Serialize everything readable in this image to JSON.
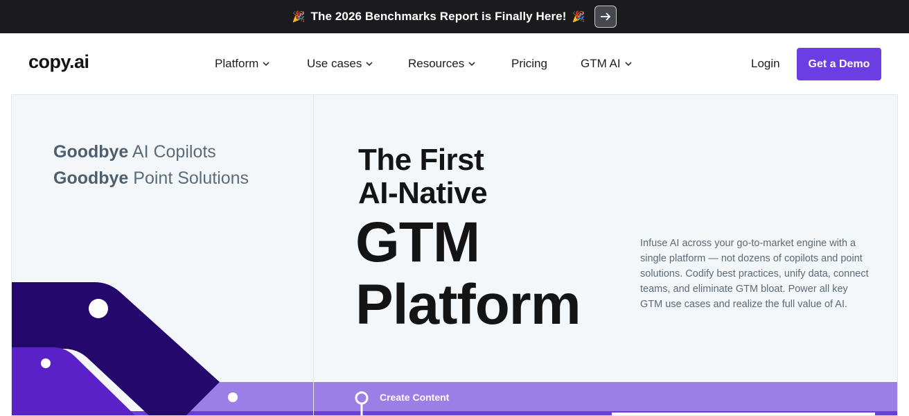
{
  "announcement": {
    "text": "The 2026 Benchmarks Report is Finally Here!",
    "left_emoji": "🎉",
    "right_emoji": "🎉",
    "arrow_icon": "arrow-right-icon"
  },
  "nav": {
    "logo": "copy.ai",
    "items": [
      {
        "label": "Platform",
        "has_dropdown": true
      },
      {
        "label": "Use cases",
        "has_dropdown": true
      },
      {
        "label": "Resources",
        "has_dropdown": true
      },
      {
        "label": "Pricing",
        "has_dropdown": false
      },
      {
        "label": "GTM AI",
        "has_dropdown": true
      }
    ],
    "chevron": "⌄",
    "login": "Login",
    "cta": "Get a Demo"
  },
  "hero": {
    "goodbye_1_bold": "Goodbye",
    "goodbye_1_rest": " AI Copilots",
    "goodbye_2_bold": "Goodbye",
    "goodbye_2_rest": " Point Solutions",
    "headline_line1": "The First",
    "headline_line2": "AI-Native",
    "headline_line3": "GTM",
    "headline_line4": "Platform",
    "description": "Infuse AI across your go-to-market engine with a single platform — not dozens of copilots and point solutions. Codify best practices, unify data, connect teams, and eliminate GTM bloat. Power all key GTM use cases and realize the full value of AI.",
    "track_label": "Create Content"
  },
  "colors": {
    "accent": "#6b3de2",
    "dark_purple": "#24086b",
    "mid_purple": "#5b21c8",
    "light_purple": "#9b7ee6",
    "announce_bg": "#1b1a1d",
    "hero_bg": "#f4f7f9"
  }
}
